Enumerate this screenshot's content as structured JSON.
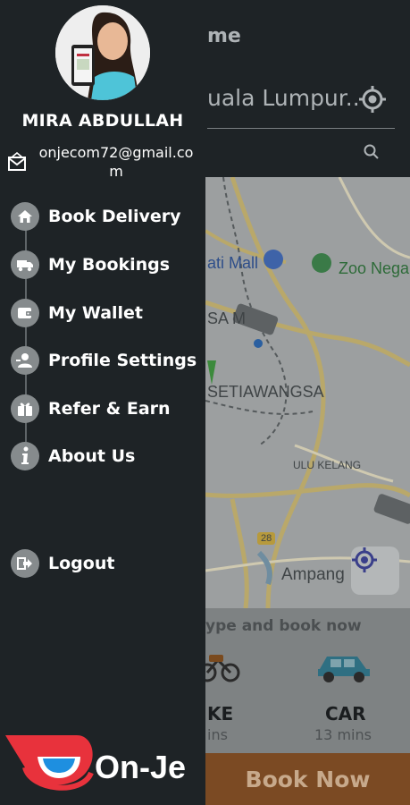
{
  "background": {
    "header_title": "me",
    "location_text": "uala Lumpur..",
    "map_labels": {
      "mall": "ati Mall",
      "zoo": "Zoo Negar",
      "sa": "SA M",
      "setiawangsa": "SETIAWANGSA",
      "ulu_kelang": "ULU KELANG",
      "ampang": "Ampang",
      "road_28": "28"
    },
    "vehicle_panel": {
      "title": "ype and book now",
      "bike_name": "KE",
      "bike_time": "ins",
      "car_name": "CAR",
      "car_time": "13 mins"
    },
    "book_now": "Book Now"
  },
  "drawer": {
    "user_name": "MIRA ABDULLAH",
    "email": "onjecom72@gmail.com",
    "menu": [
      {
        "label": "Book Delivery",
        "icon": "home-icon"
      },
      {
        "label": "My Bookings",
        "icon": "truck-icon"
      },
      {
        "label": "My Wallet",
        "icon": "wallet-icon"
      },
      {
        "label": "Profile Settings",
        "icon": "user-icon"
      },
      {
        "label": "Refer & Earn",
        "icon": "gift-icon"
      },
      {
        "label": "About Us",
        "icon": "info-icon"
      }
    ],
    "logout": "Logout",
    "logo_text": "On-Je"
  },
  "colors": {
    "drawer_bg": "#1e2326",
    "brand_red": "#e8323c",
    "brand_blue": "#1e8fe0",
    "book_now": "#d9722a"
  }
}
